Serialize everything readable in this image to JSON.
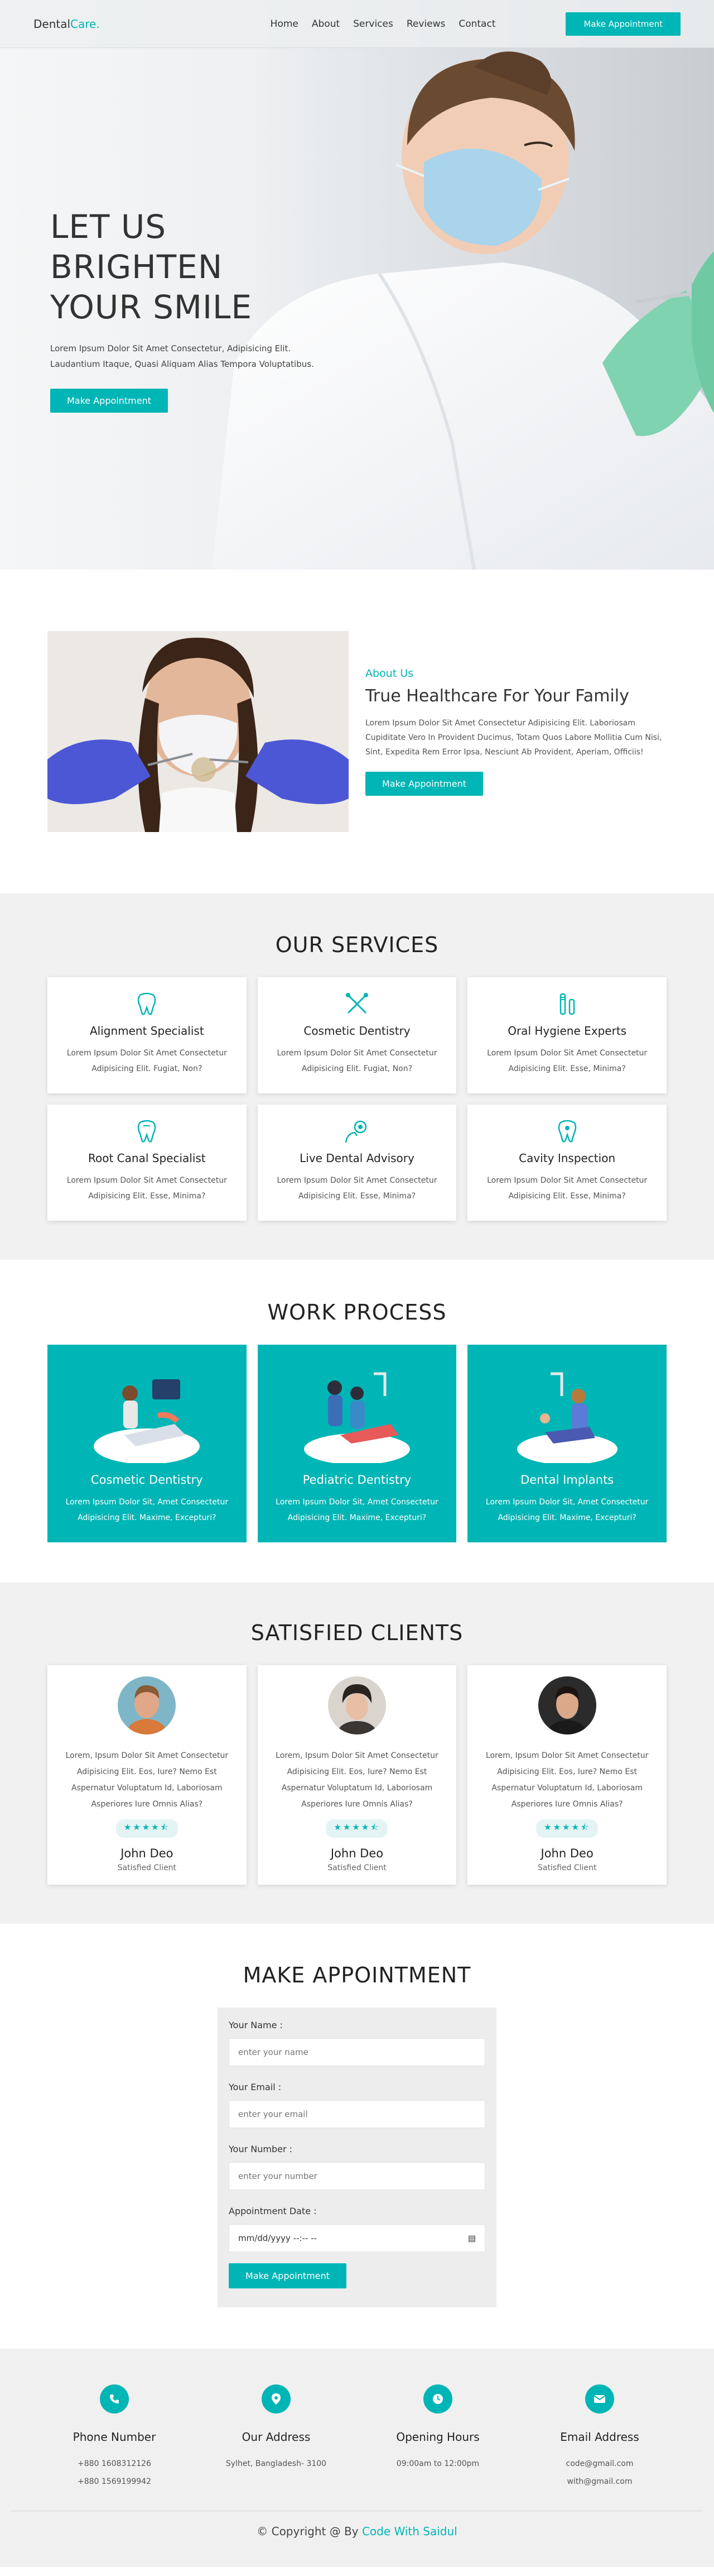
{
  "header": {
    "logo_main": "Dental",
    "logo_accent": "Care.",
    "nav": [
      "Home",
      "About",
      "Services",
      "Reviews",
      "Contact"
    ],
    "cta": "Make Appointment"
  },
  "hero": {
    "title_line1": "LET US BRIGHTEN",
    "title_line2": "YOUR SMILE",
    "desc_line1": "Lorem Ipsum Dolor Sit Amet Consectetur, Adipisicing Elit.",
    "desc_line2": "Laudantium Itaque, Quasi Aliquam Alias Tempora Voluptatibus.",
    "cta": "Make Appointment"
  },
  "about": {
    "subtitle": "About Us",
    "title": "True Healthcare For Your Family",
    "desc": "Lorem Ipsum Dolor Sit Amet Consectetur Adipisicing Elit. Laboriosam Cupiditate Vero In Provident Ducimus, Totam Quos Labore Mollitia Cum Nisi, Sint, Expedita Rem Error Ipsa, Nesciunt Ab Provident, Aperiam, Officiis!",
    "cta": "Make Appointment"
  },
  "services": {
    "title": "OUR SERVICES",
    "items": [
      {
        "title": "Alignment Specialist",
        "desc": "Lorem Ipsum Dolor Sit Amet Consectetur Adipisicing Elit. Fugiat, Non?",
        "icon": "tooth-icon"
      },
      {
        "title": "Cosmetic Dentistry",
        "desc": "Lorem Ipsum Dolor Sit Amet Consectetur Adipisicing Elit. Fugiat, Non?",
        "icon": "dental-tools-icon"
      },
      {
        "title": "Oral Hygiene Experts",
        "desc": "Lorem Ipsum Dolor Sit Amet Consectetur Adipisicing Elit. Esse, Minima?",
        "icon": "toothbrush-icon"
      },
      {
        "title": "Root Canal Specialist",
        "desc": "Lorem Ipsum Dolor Sit Amet Consectetur Adipisicing Elit. Esse, Minima?",
        "icon": "tooth-root-icon"
      },
      {
        "title": "Live Dental Advisory",
        "desc": "Lorem Ipsum Dolor Sit Amet Consectetur Adipisicing Elit. Esse, Minima?",
        "icon": "dentist-advisor-icon"
      },
      {
        "title": "Cavity Inspection",
        "desc": "Lorem Ipsum Dolor Sit Amet Consectetur Adipisicing Elit. Esse, Minima?",
        "icon": "cavity-tooth-icon"
      }
    ]
  },
  "work": {
    "title": "WORK PROCESS",
    "items": [
      {
        "title": "Cosmetic Dentistry",
        "desc": "Lorem Ipsum Dolor Sit, Amet Consectetur Adipisicing Elit. Maxime, Excepturi?"
      },
      {
        "title": "Pediatric Dentistry",
        "desc": "Lorem Ipsum Dolor Sit, Amet Consectetur Adipisicing Elit. Maxime, Excepturi?"
      },
      {
        "title": "Dental Implants",
        "desc": "Lorem Ipsum Dolor Sit, Amet Consectetur Adipisicing Elit. Maxime, Excepturi?"
      }
    ]
  },
  "clients": {
    "title": "SATISFIED CLIENTS",
    "items": [
      {
        "text": "Lorem, Ipsum Dolor Sit Amet Consectetur Adipisicing Elit. Eos, Iure? Nemo Est Aspernatur Voluptatum Id, Laboriosam Asperiores Iure Omnis Alias?",
        "name": "John Deo",
        "role": "Satisfied Client",
        "rating": 4.5
      },
      {
        "text": "Lorem, Ipsum Dolor Sit Amet Consectetur Adipisicing Elit. Eos, Iure? Nemo Est Aspernatur Voluptatum Id, Laboriosam Asperiores Iure Omnis Alias?",
        "name": "John Deo",
        "role": "Satisfied Client",
        "rating": 4.5
      },
      {
        "text": "Lorem, Ipsum Dolor Sit Amet Consectetur Adipisicing Elit. Eos, Iure? Nemo Est Aspernatur Voluptatum Id, Laboriosam Asperiores Iure Omnis Alias?",
        "name": "John Deo",
        "role": "Satisfied Client",
        "rating": 4.5
      }
    ]
  },
  "appointment": {
    "title": "MAKE APPOINTMENT",
    "name_label": "Your Name :",
    "name_placeholder": "enter your name",
    "email_label": "Your Email :",
    "email_placeholder": "enter your email",
    "number_label": "Your Number :",
    "number_placeholder": "enter your number",
    "date_label": "Appointment Date :",
    "date_placeholder": "mm/dd/yyyy --:-- --",
    "submit": "Make Appointment"
  },
  "footer": {
    "phone_title": "Phone Number",
    "phone_1": "+880 1608312126",
    "phone_2": "+880 1569199942",
    "address_title": "Our Address",
    "address": "Sylhet, Bangladesh- 3100",
    "hours_title": "Opening Hours",
    "hours": "09:00am to 12:00pm",
    "email_title": "Email Address",
    "email_1": "code@gmail.com",
    "email_2": "with@gmail.com",
    "copyright_prefix": "© Copyright @ By",
    "copyright_author": "Code With Saidul"
  },
  "colors": {
    "accent": "#00b5b5"
  }
}
